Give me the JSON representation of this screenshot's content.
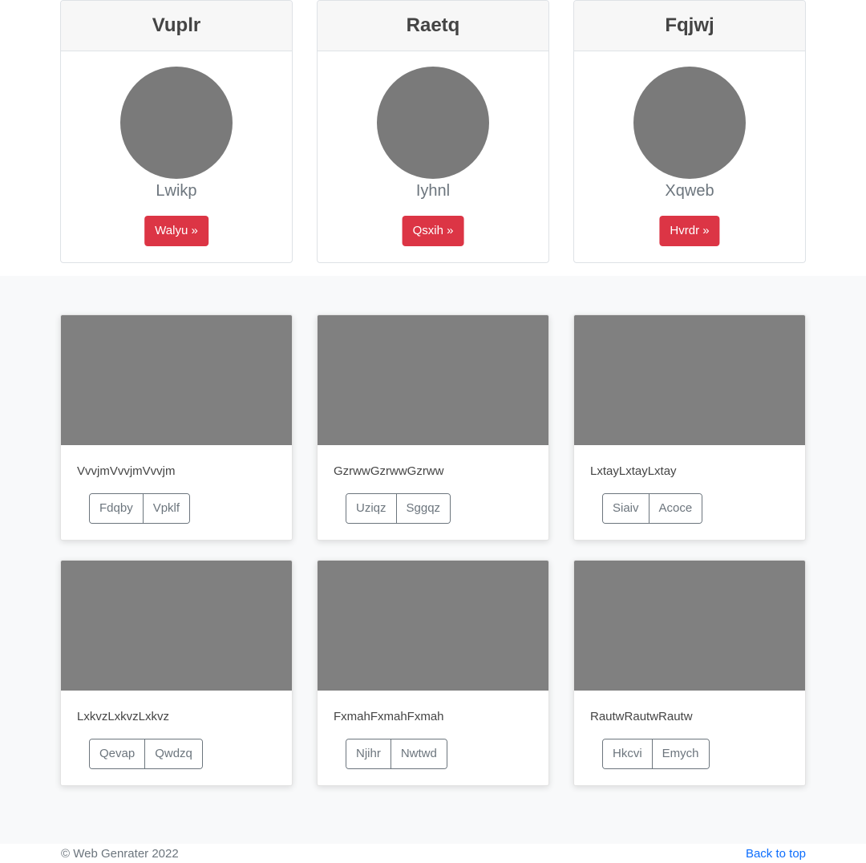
{
  "pricing_cards": [
    {
      "title": "Vuplr",
      "subtitle": "Lwikp",
      "button": "Walyu »"
    },
    {
      "title": "Raetq",
      "subtitle": "Iyhnl",
      "button": "Qsxih »"
    },
    {
      "title": "Fqjwj",
      "subtitle": "Xqweb",
      "button": "Hvrdr »"
    }
  ],
  "album_cards": [
    {
      "text": "VvvjmVvvjmVvvjm",
      "buttons": [
        "Fdqby",
        "Vpklf"
      ]
    },
    {
      "text": "GzrwwGzrwwGzrww",
      "buttons": [
        "Uziqz",
        "Sggqz"
      ]
    },
    {
      "text": "LxtayLxtayLxtay",
      "buttons": [
        "Siaiv",
        "Acoce"
      ]
    },
    {
      "text": "LxkvzLxkvzLxkvz",
      "buttons": [
        "Qevap",
        "Qwdzq"
      ]
    },
    {
      "text": "FxmahFxmahFxmah",
      "buttons": [
        "Njihr",
        "Nwtwd"
      ]
    },
    {
      "text": "RautwRautwRautw",
      "buttons": [
        "Hkcvi",
        "Emych"
      ]
    }
  ],
  "footer": {
    "copyright": "© Web Genrater 2022",
    "back_to_top": "Back to top"
  },
  "colors": {
    "primary_button": "#dc3545",
    "link": "#0d6efd",
    "placeholder": "#808080"
  }
}
